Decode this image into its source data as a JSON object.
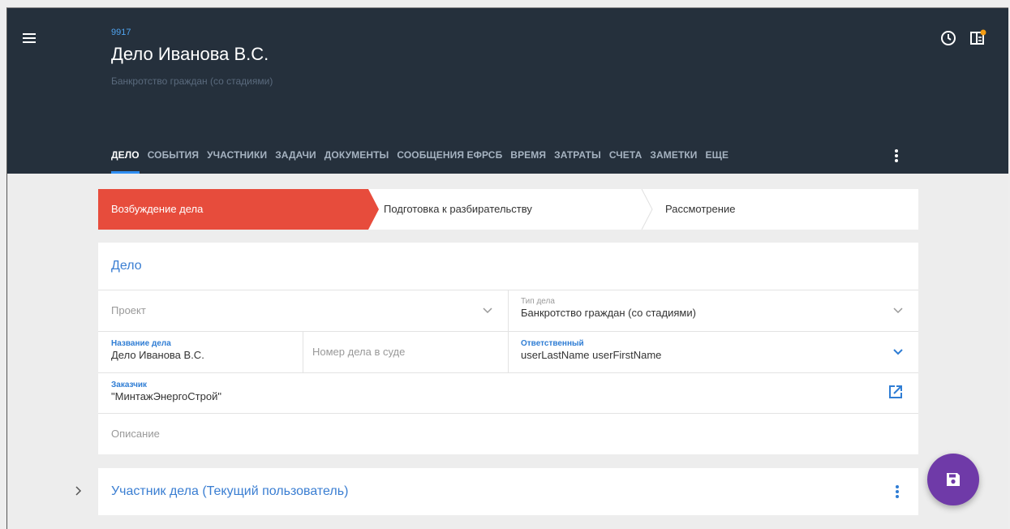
{
  "header": {
    "case_id": "9917",
    "title": "Дело Иванова В.С.",
    "subtitle": "Банкротство граждан (со стадиями)"
  },
  "tabs": [
    {
      "label": "ДЕЛО",
      "active": true
    },
    {
      "label": "СОБЫТИЯ"
    },
    {
      "label": "УЧАСТНИКИ"
    },
    {
      "label": "ЗАДАЧИ"
    },
    {
      "label": "ДОКУМЕНТЫ"
    },
    {
      "label": "СООБЩЕНИЯ ЕФРСБ"
    },
    {
      "label": "ВРЕМЯ"
    },
    {
      "label": "ЗАТРАТЫ"
    },
    {
      "label": "СЧЕТА"
    },
    {
      "label": "ЗАМЕТКИ"
    },
    {
      "label": "ЕЩЕ"
    }
  ],
  "stages": [
    {
      "label": "Возбуждение дела",
      "active": true
    },
    {
      "label": "Подготовка к разбирательству"
    },
    {
      "label": "Рассмотрение"
    }
  ],
  "case_card": {
    "title": "Дело",
    "project_placeholder": "Проект",
    "type_label": "Тип дела",
    "type_value": "Банкротство граждан (со стадиями)",
    "name_label": "Название дела",
    "name_value": "Дело Иванова В.С.",
    "court_number_placeholder": "Номер дела в суде",
    "responsible_label": "Ответственный",
    "responsible_value": "userLastName userFirstName",
    "customer_label": "Заказчик",
    "customer_value": "\"МинтажЭнергоСтрой\"",
    "description_placeholder": "Описание"
  },
  "participant_card": {
    "title": "Участник дела (Текущий пользователь)"
  },
  "colors": {
    "header_bg": "#25303c",
    "accent_blue": "#2f8ef2",
    "stage_active": "#e74c3c",
    "fab": "#6f3aa8",
    "notification_dot": "#f39c12"
  },
  "icons": [
    "menu-icon",
    "clock-icon",
    "panel-icon",
    "more-vert-icon",
    "chevron-down-icon",
    "open-external-icon",
    "chevron-right-icon",
    "save-icon"
  ]
}
